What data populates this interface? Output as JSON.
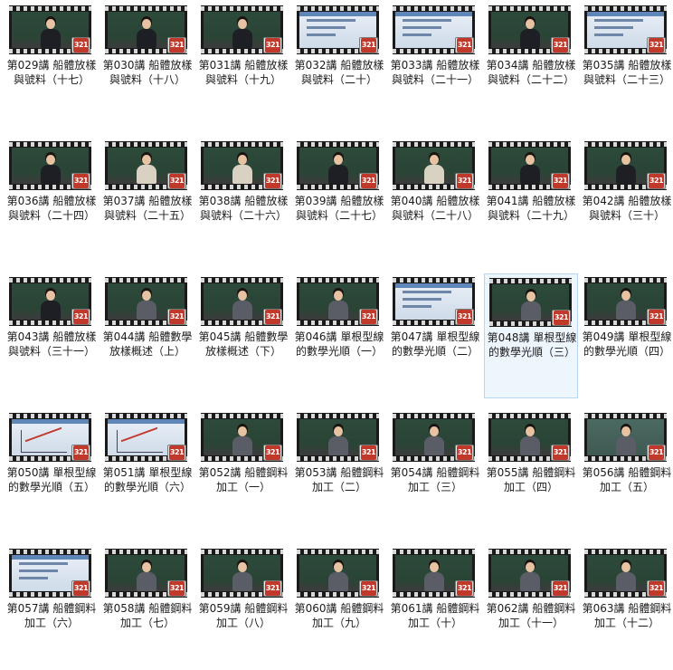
{
  "badge_text": "321",
  "items": [
    {
      "label": "第029講 船體放樣與號料（十七）",
      "frame": "board",
      "person": "dark"
    },
    {
      "label": "第030講 船體放樣與號料（十八）",
      "frame": "board",
      "person": "dark"
    },
    {
      "label": "第031講 船體放樣與號料（十九）",
      "frame": "board",
      "person": "dark"
    },
    {
      "label": "第032講 船體放樣與號料（二十）",
      "frame": "slide",
      "person": "none"
    },
    {
      "label": "第033講 船體放樣與號料（二十一）",
      "frame": "slide",
      "person": "none"
    },
    {
      "label": "第034講 船體放樣與號料（二十二）",
      "frame": "board",
      "person": "dark"
    },
    {
      "label": "第035講 船體放樣與號料（二十三）",
      "frame": "slide",
      "person": "none"
    },
    {
      "label": "第036講 船體放樣與號料（二十四）",
      "frame": "board",
      "person": "dark"
    },
    {
      "label": "第037講 船體放樣與號料（二十五）",
      "frame": "board",
      "person": "light"
    },
    {
      "label": "第038講 船體放樣與號料（二十六）",
      "frame": "board",
      "person": "light"
    },
    {
      "label": "第039講 船體放樣與號料（二十七）",
      "frame": "board",
      "person": "dark"
    },
    {
      "label": "第040講 船體放樣與號料（二十八）",
      "frame": "board",
      "person": "light"
    },
    {
      "label": "第041講 船體放樣與號料（二十九）",
      "frame": "board",
      "person": "dark"
    },
    {
      "label": "第042講 船體放樣與號料（三十）",
      "frame": "board",
      "person": "dark"
    },
    {
      "label": "第043講 船體放樣與號料（三十一）",
      "frame": "board",
      "person": "dark"
    },
    {
      "label": "第044講 船體數學放樣概述（上）",
      "frame": "board",
      "person": "grey"
    },
    {
      "label": "第045講 船體數學放樣概述（下）",
      "frame": "board",
      "person": "grey"
    },
    {
      "label": "第046講 單根型線的數學光順（一）",
      "frame": "board",
      "person": "grey"
    },
    {
      "label": "第047講 單根型線的數學光順（二）",
      "frame": "slide",
      "person": "none"
    },
    {
      "label": "第048講 單根型線的數學光順（三）",
      "frame": "board",
      "person": "grey",
      "selected": true
    },
    {
      "label": "第049講 單根型線的數學光順（四）",
      "frame": "board",
      "person": "grey"
    },
    {
      "label": "第050講 單根型線的數學光順（五）",
      "frame": "chart",
      "person": "none"
    },
    {
      "label": "第051講 單根型線的數學光順（六）",
      "frame": "chart",
      "person": "none"
    },
    {
      "label": "第052講 船體鋼料加工（一）",
      "frame": "board",
      "person": "grey"
    },
    {
      "label": "第053講 船體鋼料加工（二）",
      "frame": "board",
      "person": "grey"
    },
    {
      "label": "第054講 船體鋼料加工（三）",
      "frame": "board",
      "person": "grey"
    },
    {
      "label": "第055講 船體鋼料加工（四）",
      "frame": "board",
      "person": "grey"
    },
    {
      "label": "第056講 船體鋼料加工（五）",
      "frame": "mixed",
      "person": "grey"
    },
    {
      "label": "第057講 船體鋼料加工（六）",
      "frame": "slide",
      "person": "none"
    },
    {
      "label": "第058講 船體鋼料加工（七）",
      "frame": "board",
      "person": "grey"
    },
    {
      "label": "第059講 船體鋼料加工（八）",
      "frame": "board",
      "person": "grey"
    },
    {
      "label": "第060講 船體鋼料加工（九）",
      "frame": "board",
      "person": "grey"
    },
    {
      "label": "第061講 船體鋼料加工（十）",
      "frame": "board",
      "person": "grey"
    },
    {
      "label": "第062講 船體鋼料加工（十一）",
      "frame": "board",
      "person": "grey"
    },
    {
      "label": "第063講 船體鋼料加工（十二）",
      "frame": "board",
      "person": "grey"
    }
  ]
}
